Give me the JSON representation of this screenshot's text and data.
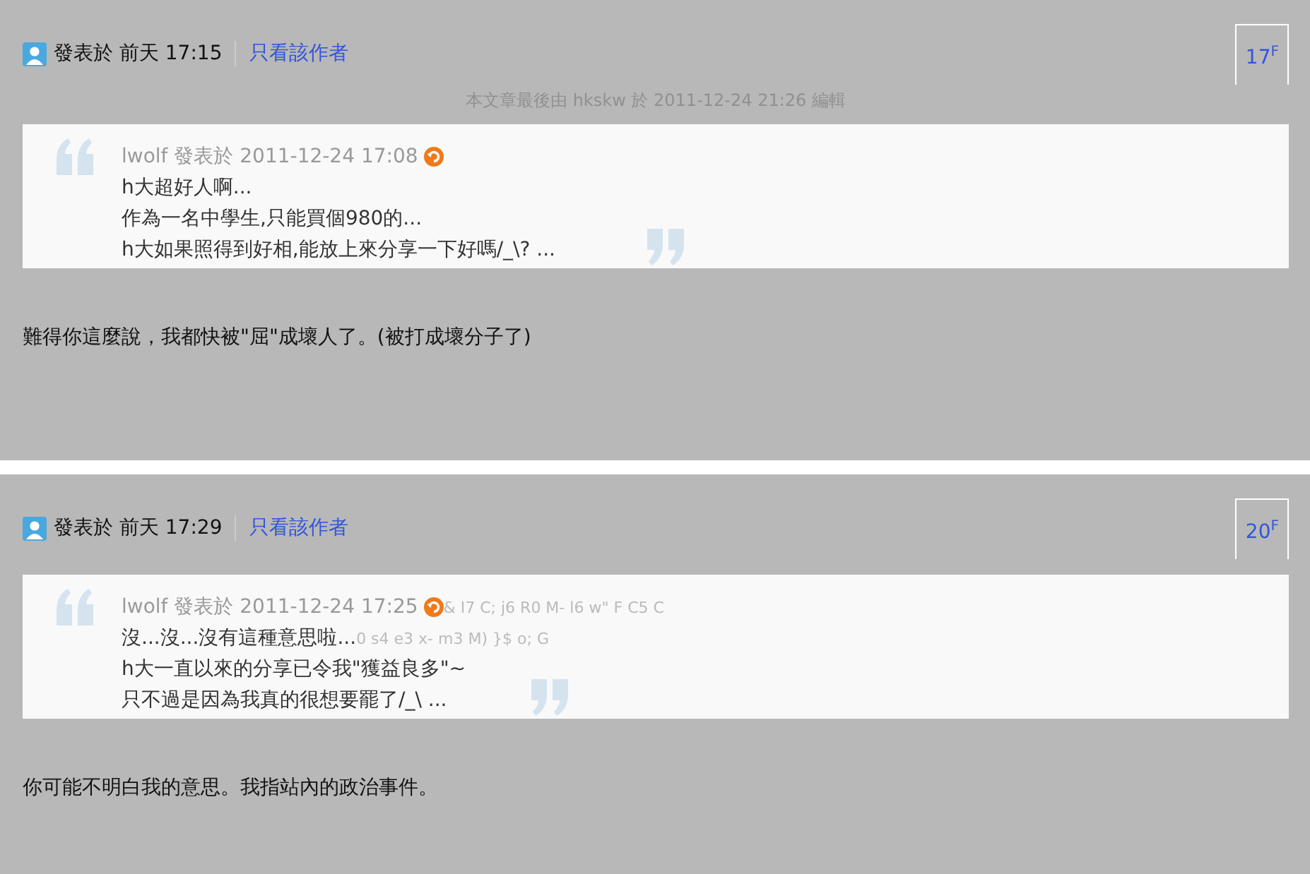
{
  "posts": [
    {
      "posted_label": "發表於",
      "time": "前天 17:15",
      "author_only_link": "只看該作者",
      "floor": "17$^{F}$",
      "edit_note": "本文章最後由 hkskw 於 2011-12-24 21:26 編輯",
      "quote": {
        "author": "lwolf",
        "posted": "發表於 2011-12-24 17:08",
        "lines": [
          {
            "text": "h大超好人啊..."
          },
          {
            "text": "作為一名中學生,只能買個980的..."
          },
          {
            "text": "h大如果照得到好相,能放上來分享一下好嗎/_\\? ..."
          }
        ]
      },
      "body": "難得你這麼說，我都快被\"屈\"成壞人了。(被打成壞分子了)"
    },
    {
      "posted_label": "發表於",
      "time": "前天 17:29",
      "author_only_link": "只看該作者",
      "floor": "20$^{F}$",
      "quote": {
        "author": "lwolf",
        "posted": "發表於 2011-12-24 17:25",
        "trail": "& I7 C; j6 R0 M- l6 w\" F  C5 C",
        "lines": [
          {
            "text": "沒...沒...沒有這種意思啦...",
            "trail": "0 s4 e3 x- m3 M) }$ o; G"
          },
          {
            "text": "h大一直以來的分享已令我\"獲益良多\"~"
          },
          {
            "text": "只不過是因為我真的很想要罷了/_\\ ..."
          }
        ]
      },
      "body": "你可能不明白我的意思。我指站內的政治事件。"
    }
  ]
}
